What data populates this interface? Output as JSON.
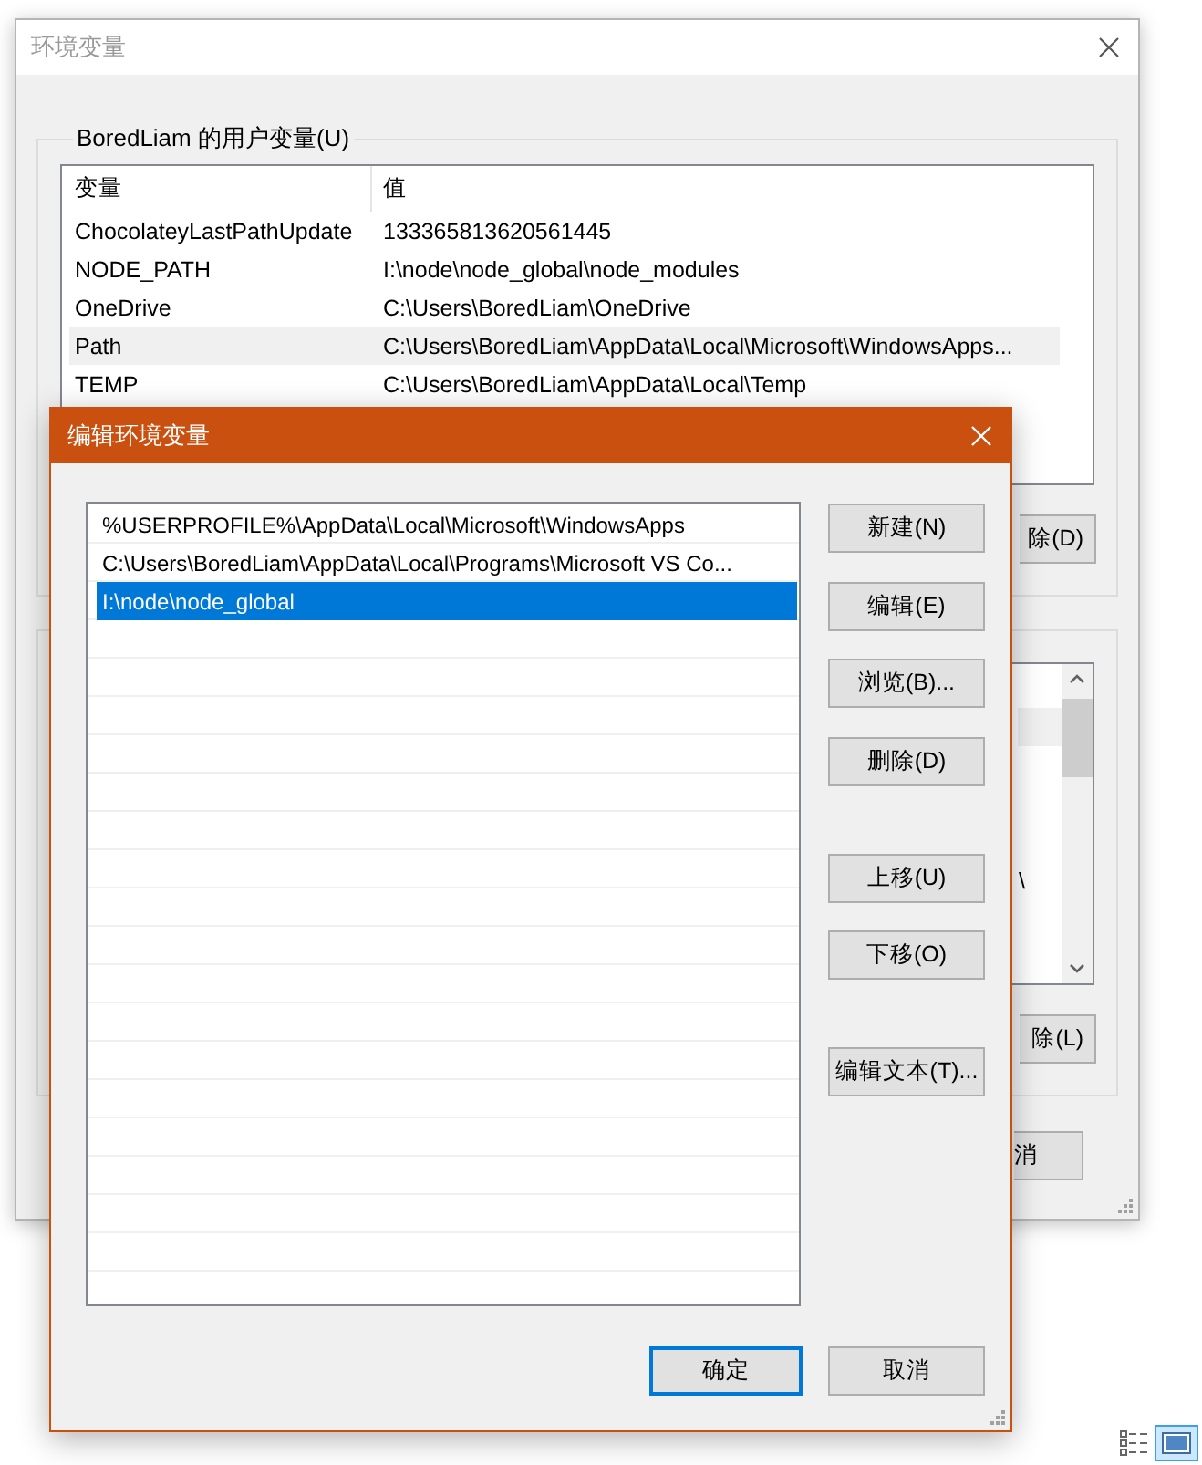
{
  "main_window": {
    "title": "环境变量",
    "user_variables": {
      "legend": "BoredLiam 的用户变量(U)",
      "columns": [
        "变量",
        "值"
      ],
      "rows": [
        {
          "name": "ChocolateyLastPathUpdate",
          "value": "133365813620561445",
          "selected": false
        },
        {
          "name": "NODE_PATH",
          "value": "I:\\node\\node_global\\node_modules",
          "selected": false
        },
        {
          "name": "OneDrive",
          "value": "C:\\Users\\BoredLiam\\OneDrive",
          "selected": false
        },
        {
          "name": "Path",
          "value": "C:\\Users\\BoredLiam\\AppData\\Local\\Microsoft\\WindowsApps...",
          "selected": true
        },
        {
          "name": "TEMP",
          "value": "C:\\Users\\BoredLiam\\AppData\\Local\\Temp",
          "selected": false
        }
      ],
      "button": "除(D)"
    },
    "system_variables": {
      "rows": [
        {
          "selected": false
        },
        {
          "selected": true
        },
        {
          "selected": false
        },
        {
          "selected": false
        },
        {
          "selected": false
        },
        {
          "text": "\\",
          "selected": false
        }
      ],
      "button": "除(L)"
    },
    "footer_button": "消"
  },
  "edit_dialog": {
    "title": "编辑环境变量",
    "entries": [
      {
        "text": "%USERPROFILE%\\AppData\\Local\\Microsoft\\WindowsApps",
        "selected": false
      },
      {
        "text": "C:\\Users\\BoredLiam\\AppData\\Local\\Programs\\Microsoft VS Co...",
        "selected": false
      },
      {
        "text": "I:\\node\\node_global",
        "selected": true
      }
    ],
    "side_buttons": [
      [
        "新建(N)",
        "编辑(E)",
        "浏览(B)...",
        "删除(D)"
      ],
      [
        "上移(U)",
        "下移(O)"
      ],
      [
        "编辑文本(T)..."
      ]
    ],
    "footer_buttons": [
      {
        "label": "确定",
        "default": true
      },
      {
        "label": "取消",
        "default": false
      }
    ]
  },
  "view_buttons": [
    {
      "kind": "details",
      "selected": false
    },
    {
      "kind": "preview",
      "selected": true
    }
  ]
}
